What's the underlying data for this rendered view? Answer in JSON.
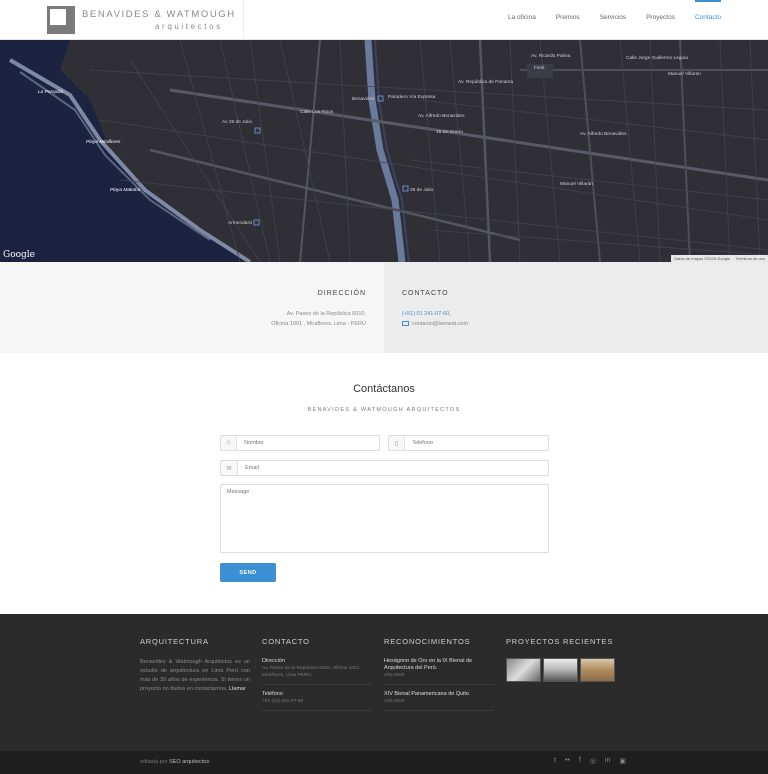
{
  "header": {
    "logo_name": "BENAVIDES & WATMOUGH",
    "logo_sub": "arquitectos",
    "nav": [
      {
        "label": "La oficina"
      },
      {
        "label": "Premios"
      },
      {
        "label": "Servicios"
      },
      {
        "label": "Proyectos"
      },
      {
        "label": "Contacto",
        "active": true
      }
    ]
  },
  "map": {
    "labels": [
      "Av. Ricardo Palma",
      "Field",
      "Calle Jorge Guillermo Leguia",
      "Manuel Villaran",
      "La Pampilla",
      "Playa Miraflores",
      "Playa Makaha",
      "Av 28 de Julio",
      "Benavides",
      "Paradero Vía Expresa",
      "Av. Alfredo Benavides",
      "15 De Enero",
      "28 de Julio",
      "Av. República de Panamá",
      "Armendariz",
      "Av. Alfredo Benavides",
      "Calle Los Pinos",
      "Manuel Villarán"
    ],
    "google": "Google",
    "attribution": "Datos de mapas ©2015 Google",
    "terms": "Términos de uso"
  },
  "address": {
    "title": "DIRECCIÓN",
    "line1": "Av. Paseo de la República 6010,",
    "line2": "Oficina 1001 , Miraflores. Lima - PERÚ"
  },
  "contact": {
    "title": "CONTACTO",
    "phone": "(+51) 01 241-07-60,",
    "email": "contacto@benwat.com"
  },
  "form": {
    "title": "Contáctanos",
    "subtitle": "BENAVIDES & WATMOUGH ARQUITECTOS",
    "name_placeholder": "Nombre",
    "phone_placeholder": "Teléfono",
    "email_placeholder": "Email",
    "message_placeholder": "Message",
    "send_label": "SEND"
  },
  "footer": {
    "arq_title": "ARQUITECTURA",
    "arq_text": "Benavides & Watmough Arquitectos es un estudio de arquitectura en Lima Perú con más de 30 años de experiencia. Si tienes un proyecto no dudes en contactarnos.",
    "arq_link": "Llamar",
    "contact_title": "CONTACTO",
    "dir_label": "Dirección",
    "dir_text": "Av. Paseo de la República 6010, Oficina 1001 Miraflores, Lima PERÚ.",
    "tel_label": "Teléfono",
    "tel_text": "+51 (01) 241-07-60",
    "rec_title": "RECONOCIMIENTOS",
    "rec": [
      {
        "title": "Hexágono de Oro en la IX Bienal de Arquitectura del Perú.",
        "sub": "Año 2000"
      },
      {
        "title": "XIV Bienal Panamericana de Quito",
        "sub": "Año 2004"
      }
    ],
    "proj_title": "PROYECTOS RECIENTES",
    "credit_prefix": "editada por",
    "credit_link": "SEO arquitectos"
  },
  "socials": [
    "t",
    "••",
    "f",
    "◎",
    "in",
    "▣"
  ],
  "colors": {
    "accent": "#3c8fd2",
    "footer_bg": "#2b2b2b",
    "map_bg": "#2f2f35"
  }
}
